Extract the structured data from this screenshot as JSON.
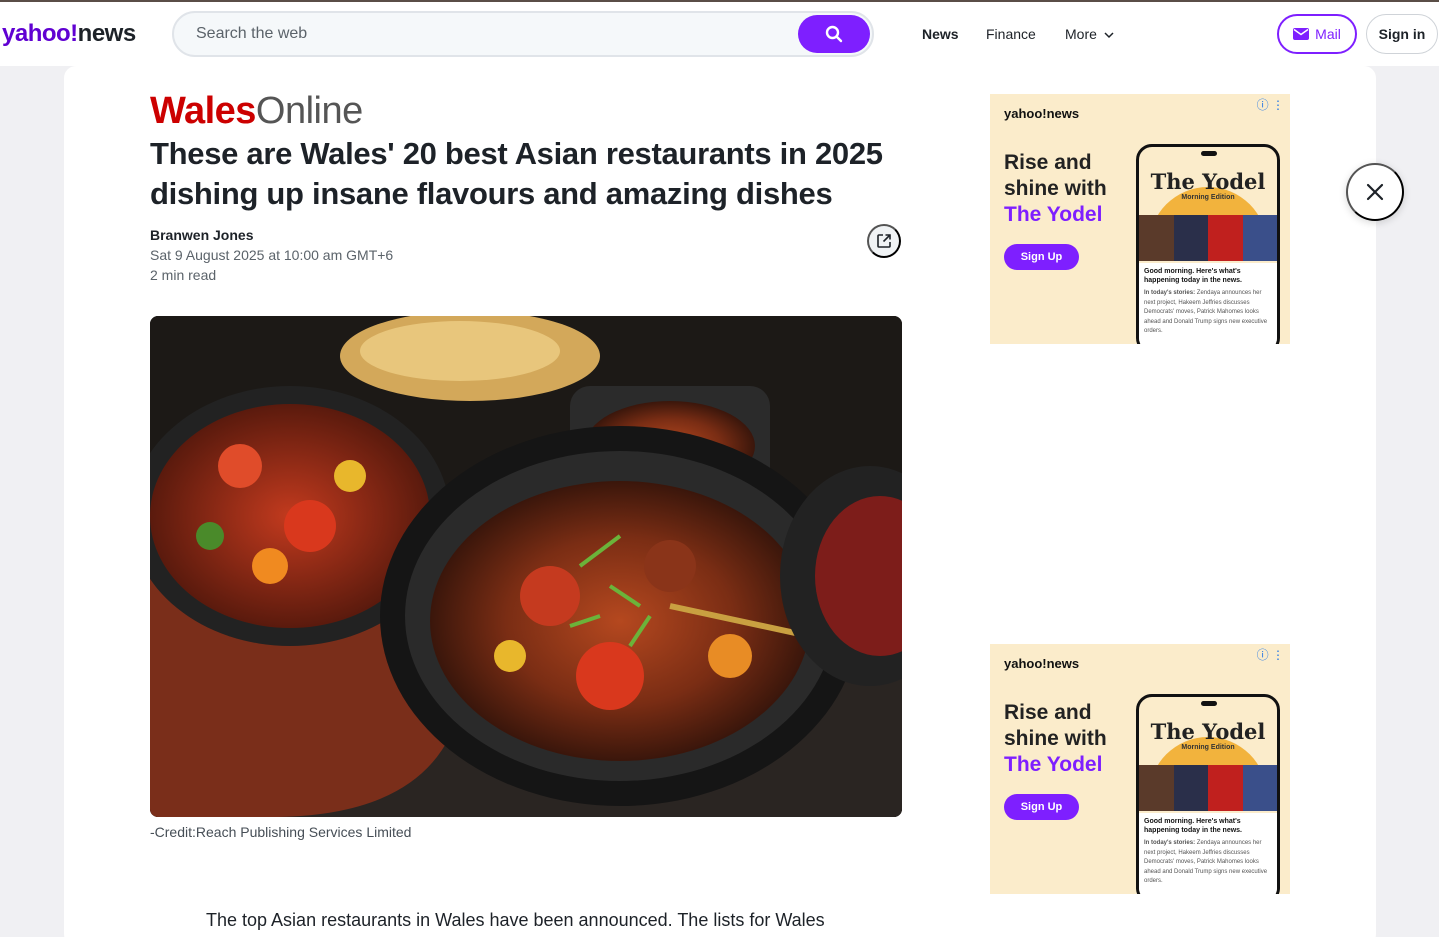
{
  "header": {
    "logo_yahoo": "yahoo!",
    "logo_news": "news",
    "search_placeholder": "Search the web",
    "nav": [
      "News",
      "Finance",
      "More"
    ],
    "mail_label": "Mail",
    "signin_label": "Sign in"
  },
  "article": {
    "publisher_red": "Wales",
    "publisher_grey": "Online",
    "title": "These are Wales' 20 best Asian restaurants in 2025 dishing up insane flavours and amazing dishes",
    "author": "Branwen Jones",
    "date": "Sat 9 August 2025 at 10:00 am GMT+6",
    "read_time": "2 min read",
    "photo_credit": "-Credit:Reach Publishing Services Limited",
    "body_first_line": "The top Asian restaurants in Wales have been announced. The lists for Wales"
  },
  "ads": [
    {
      "logo": "yahoo!news",
      "headline_1": "Rise and shine with",
      "headline_2": "The Yodel",
      "button": "Sign Up",
      "phone_title": "The Yodel",
      "phone_subtitle": "Morning Edition",
      "phone_greeting": "Good morning. Here's what's happening today in the news.",
      "phone_stories_label": "In today's stories:",
      "phone_stories": "Zendaya announces her next project, Hakeem Jeffries discusses Democrats' moves, Patrick Mahomes looks ahead and Donald Trump signs new executive orders."
    },
    {
      "logo": "yahoo!news",
      "headline_1": "Rise and shine with",
      "headline_2": "The Yodel",
      "button": "Sign Up",
      "phone_title": "The Yodel",
      "phone_subtitle": "Morning Edition",
      "phone_greeting": "Good morning. Here's what's happening today in the news.",
      "phone_stories_label": "In today's stories:",
      "phone_stories": "Zendaya announces her next project, Hakeem Jeffries discusses Democrats' moves, Patrick Mahomes looks ahead and Donald Trump signs new executive orders."
    }
  ],
  "colors": {
    "brand_purple": "#7e1fff",
    "yahoo_purple": "#6001d2",
    "wales_red": "#cc0000",
    "ad_background": "#fbeccb"
  },
  "icons": {
    "search": "search-icon",
    "mail": "mail-icon",
    "share": "share-icon",
    "close": "close-icon",
    "chevron": "chevron-down-icon",
    "ad_info": "info-icon"
  }
}
